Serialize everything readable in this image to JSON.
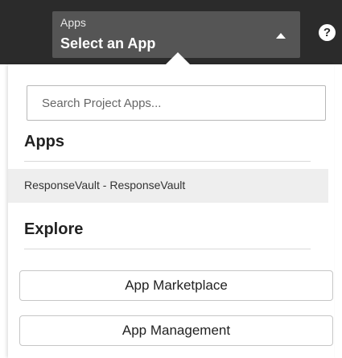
{
  "header": {
    "select_small_label": "Apps",
    "select_main_label": "Select an App",
    "help_glyph": "?"
  },
  "search": {
    "placeholder": "Search Project Apps..."
  },
  "apps_section": {
    "heading": "Apps",
    "items": [
      {
        "label": "ResponseVault - ResponseVault"
      }
    ]
  },
  "explore_section": {
    "heading": "Explore",
    "buttons": [
      {
        "label": "App Marketplace"
      },
      {
        "label": "App Management"
      }
    ]
  },
  "colors": {
    "topbar_bg": "#2b2b2b",
    "select_bg": "#555555",
    "selected_item_bg": "#eeeeee",
    "text_dark": "#222222"
  },
  "icons": {
    "caret": "caret-up-icon",
    "help": "help-circle-icon"
  }
}
